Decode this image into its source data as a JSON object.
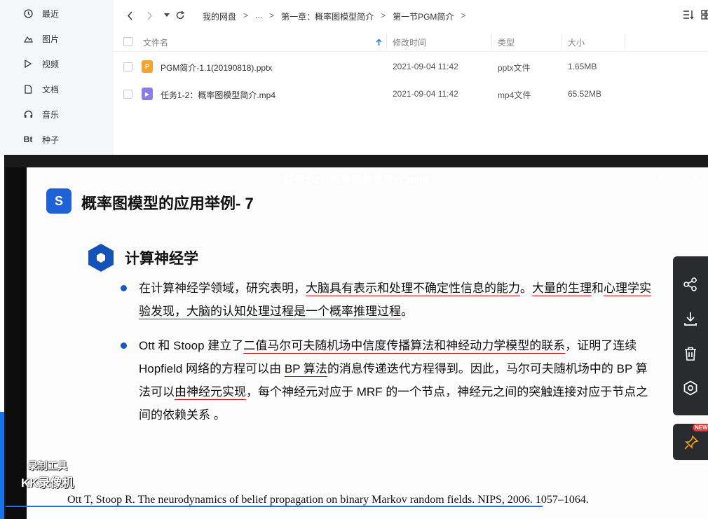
{
  "sidebar": {
    "items": [
      {
        "icon": "clock-icon",
        "label": "最近"
      },
      {
        "icon": "image-icon",
        "label": "图片"
      },
      {
        "icon": "play-icon",
        "label": "视频"
      },
      {
        "icon": "document-icon",
        "label": "文档"
      },
      {
        "icon": "headphones-icon",
        "label": "音乐"
      },
      {
        "icon": "bt-icon",
        "label": "种子",
        "glyph": "Bt"
      }
    ]
  },
  "breadcrumb": {
    "items": [
      "我的网盘",
      "...",
      "第一章：概率图模型简介",
      "第一节PGM简介"
    ],
    "separator": ">"
  },
  "file_list": {
    "columns": {
      "name": "文件名",
      "modified": "修改时间",
      "type": "类型",
      "size": "大小"
    },
    "files": [
      {
        "name": "PGM简介-1.1(20190818).pptx",
        "modified": "2021-09-04 11:42",
        "type": "pptx文件",
        "size": "1.65MB",
        "icon_color": "#f5a42d",
        "icon_glyph": "P"
      },
      {
        "name": "任务1-2：概率图模型简介.mp4",
        "modified": "2021-09-04 11:42",
        "type": "mp4文件",
        "size": "65.52MB",
        "icon_color": "#8a7de8",
        "icon_glyph": "▶"
      }
    ]
  },
  "player": {
    "title": "任务1-2：概率图模型简介.mp4",
    "controls": {
      "minimize": "–",
      "maximize": "□",
      "close": "✕"
    }
  },
  "slide": {
    "logo_glyph": "S",
    "title": "概率图模型的应用举例- 7",
    "section": "计算神经学",
    "bullets": [
      {
        "parts": [
          {
            "text": "在计算神经学领域，研究表明，",
            "ul": false
          },
          {
            "text": "大脑具有表示和处理不确定性信息的能力",
            "ul": true
          },
          {
            "text": "。",
            "ul": false
          },
          {
            "text": "大量的生理",
            "ul": true
          },
          {
            "text": "和",
            "ul": false
          },
          {
            "text": "心理学实验发现，大脑的认知处理过程是一个概率推理过程",
            "ul": true
          },
          {
            "text": "。",
            "ul": false
          }
        ]
      },
      {
        "parts": [
          {
            "text": "Ott 和 Stoop 建立了",
            "ul": false
          },
          {
            "text": "二值马尔可夫随机场中信度传播算法和神经动力学模型的联系",
            "ul": true
          },
          {
            "text": "，证明了连续 Hopfield 网络的方程可以由 ",
            "ul": false
          },
          {
            "text": "BP 算法",
            "ul": true
          },
          {
            "text": "的消息传递迭代方程得到。因此，马尔可夫随机场中的 BP 算法可以",
            "ul": false
          },
          {
            "text": "由神经元实现",
            "ul": true
          },
          {
            "text": "，每个神经元对应于 MRF 的一个节点，神经元之间的突触连接对应于节点之间的依赖关系 。",
            "ul": false
          }
        ]
      }
    ],
    "reference": "Ott T, Stoop R. The neurodynamics of belief propagation on binary Markov random fields. NIPS, 2006. 1057–1064."
  },
  "watermark": {
    "line1": "录制工具",
    "line2": "KK录像机"
  },
  "right_toolbar": {
    "icons": [
      "share-icon",
      "download-icon",
      "delete-icon",
      "settings-icon"
    ],
    "pin_icon": "pin-icon",
    "badge": "NEW"
  },
  "colors": {
    "accent": "#1957c7",
    "underline": "#c21010",
    "toolbar": "#2a2b2e"
  }
}
